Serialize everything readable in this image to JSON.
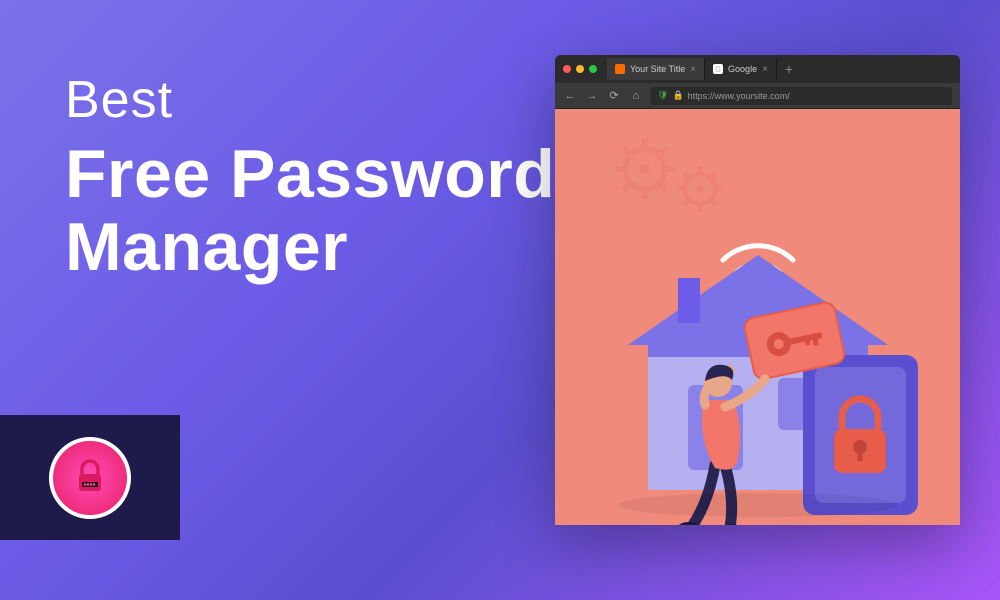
{
  "headline": {
    "line1": "Best",
    "line2": "Free Password\nManager"
  },
  "browser": {
    "tabs": [
      {
        "label": "Your Site Title",
        "active": true
      },
      {
        "label": "Google",
        "active": false
      }
    ],
    "url": "https://www.yoursite.com/"
  },
  "icons": {
    "tab_close": "×",
    "new_tab": "+",
    "nav_back": "←",
    "nav_forward": "→",
    "reload": "⟳",
    "home": "⌂",
    "shield": "🛡",
    "lock": "🔒",
    "google_g": "G"
  }
}
